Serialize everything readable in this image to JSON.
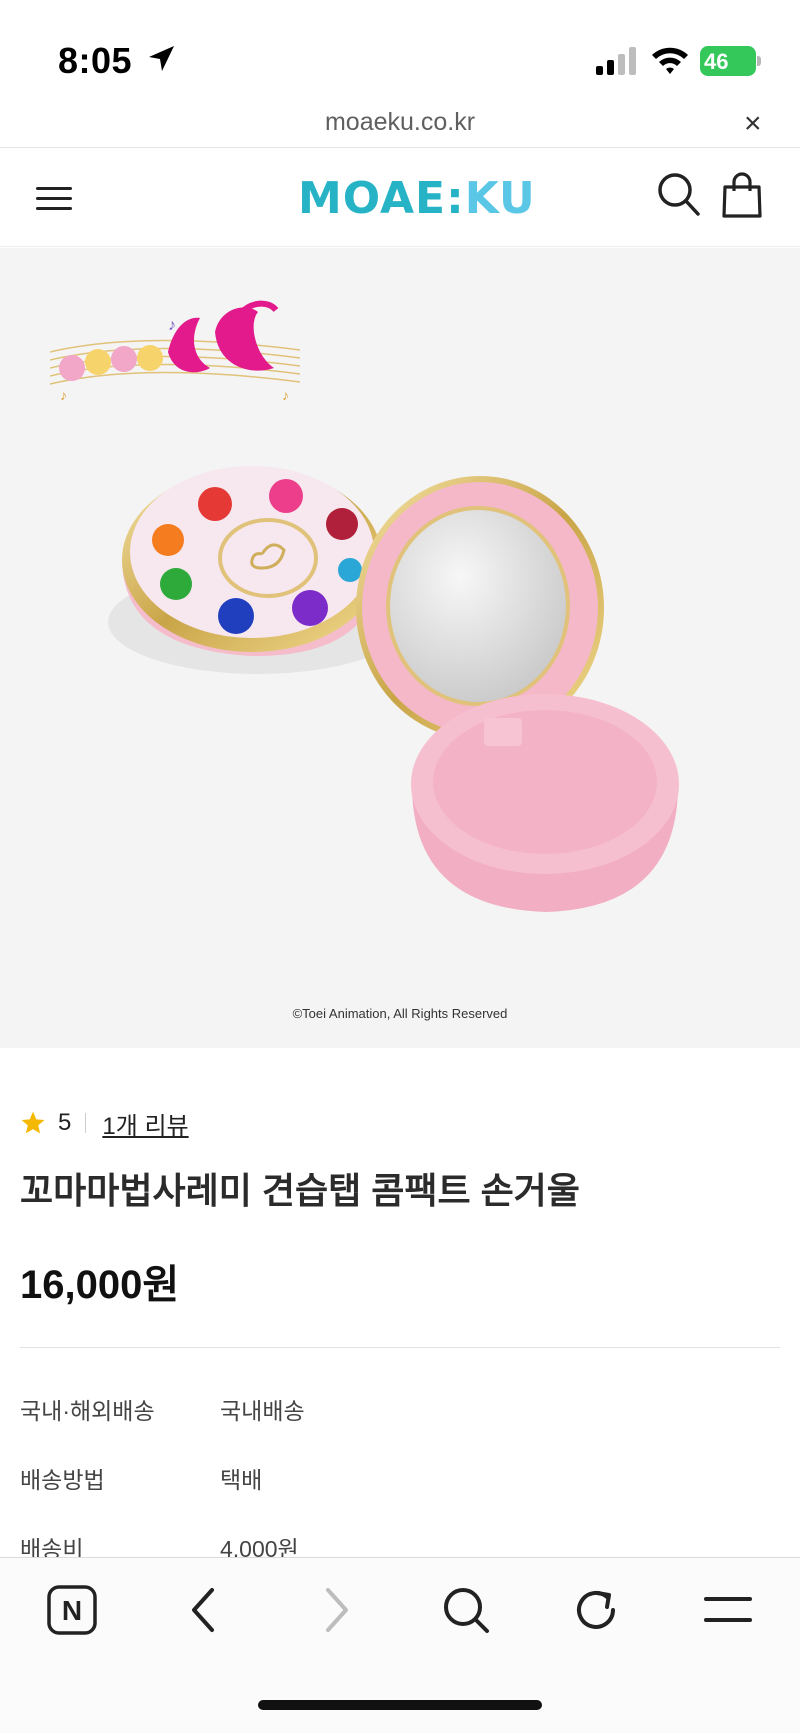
{
  "status_bar": {
    "time": "8:05",
    "battery": "46"
  },
  "url_bar": {
    "url": "moaeku.co.kr",
    "close_label": "×"
  },
  "header": {
    "logo_part1": "MOAE",
    "logo_sep": ":",
    "logo_part2": "KU"
  },
  "product_image": {
    "copyright": "©Toei Animation, All Rights Reserved"
  },
  "product": {
    "rating": "5",
    "review_count": "1개 리뷰",
    "title": "꼬마마법사레미 견습탭 콤팩트 손거울",
    "price": "16,000원",
    "info": [
      {
        "label": "국내·해외배송",
        "value": "국내배송"
      },
      {
        "label": "배송방법",
        "value": "택배"
      },
      {
        "label": "배송비",
        "value": "4,000원"
      }
    ]
  },
  "toolbar": {
    "home_letter": "N"
  },
  "colors": {
    "accent": "#27b3c6",
    "star": "#f5b800",
    "battery": "#34c759",
    "pink": "#f5bccb"
  },
  "icons": [
    "location-arrow-icon",
    "signal-icon",
    "wifi-icon",
    "menu-icon",
    "search-icon",
    "bag-icon",
    "star-icon",
    "back-icon",
    "forward-icon",
    "refresh-icon",
    "tab-menu-icon"
  ]
}
